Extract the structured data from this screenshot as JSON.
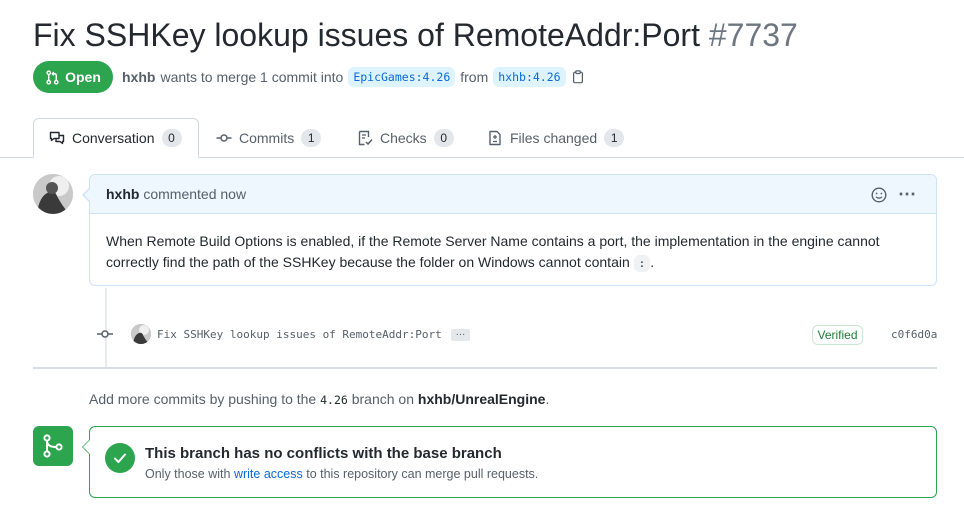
{
  "pr": {
    "title": "Fix SSHKey lookup issues of RemoteAddr:Port",
    "number": "#7737",
    "state": "Open",
    "author": "hxhb",
    "merge_text_a": "wants to merge 1 commit into",
    "base_ref": "EpicGames:4.26",
    "merge_text_b": "from",
    "head_ref": "hxhb:4.26"
  },
  "tabs": [
    {
      "label": "Conversation",
      "count": "0",
      "icon": "comment-discussion-icon"
    },
    {
      "label": "Commits",
      "count": "1",
      "icon": "git-commit-icon"
    },
    {
      "label": "Checks",
      "count": "0",
      "icon": "checklist-icon"
    },
    {
      "label": "Files changed",
      "count": "1",
      "icon": "file-diff-icon"
    }
  ],
  "comment": {
    "author": "hxhb",
    "meta": "commented now",
    "body_prefix": "When Remote Build Options is enabled, if the Remote Server Name contains a port, the implementation in the engine cannot correctly find the path of the SSHKey because the folder on Windows cannot contain",
    "body_code": ":",
    "body_suffix": "."
  },
  "commit": {
    "message": "Fix SSHKey lookup issues of RemoteAddr:Port",
    "ellipsis": "…",
    "verified": "Verified",
    "sha": "c0f6d0a"
  },
  "hint": {
    "prefix": "Add more commits by pushing to the",
    "branch": "4.26",
    "middle": "branch on",
    "repo": "hxhb/UnrealEngine",
    "suffix": "."
  },
  "merge": {
    "title": "This branch has no conflicts with the base branch",
    "sub_prefix": "Only those with",
    "sub_link": "write access",
    "sub_suffix": "to this repository can merge pull requests."
  },
  "colors": {
    "green": "#2da44e",
    "link": "#0969da",
    "muted": "#57606a"
  }
}
